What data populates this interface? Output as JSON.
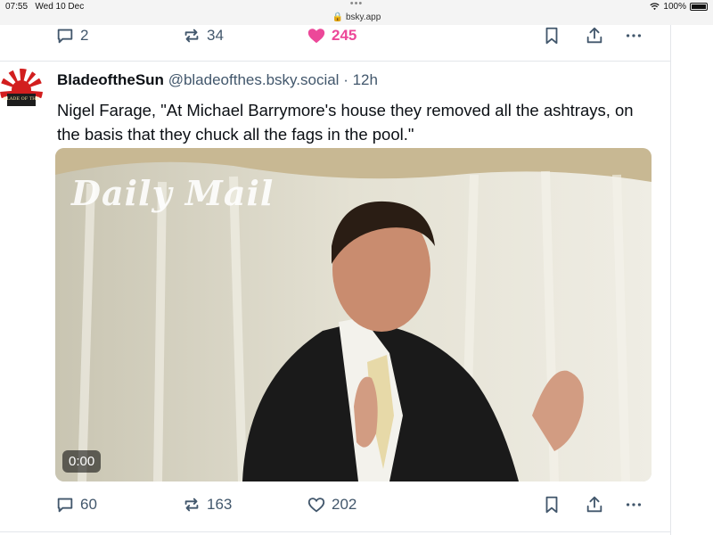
{
  "status_bar": {
    "time": "07:55",
    "date": "Wed 10 Dec",
    "url": "bsky.app",
    "battery": "100%"
  },
  "prev_post_actions": {
    "replies": "2",
    "reposts": "34",
    "likes": "245"
  },
  "post": {
    "display_name": "BladeoftheSun",
    "handle": "@bladeofthes.bsky.social",
    "separator": "·",
    "age": "12h",
    "text": "Nigel Farage, \"At Michael Barrymore's house they removed all the ashtrays, on the basis that they chuck all the fags in the pool.\"",
    "avatar_text": "BLADE OF THE",
    "video": {
      "watermark": "Daily Mail",
      "time": "0:00"
    },
    "actions": {
      "replies": "60",
      "reposts": "163",
      "likes": "202"
    }
  },
  "colors": {
    "accent_like": "#ec4899",
    "icon": "#42576c",
    "divider": "#e3e6ea"
  }
}
